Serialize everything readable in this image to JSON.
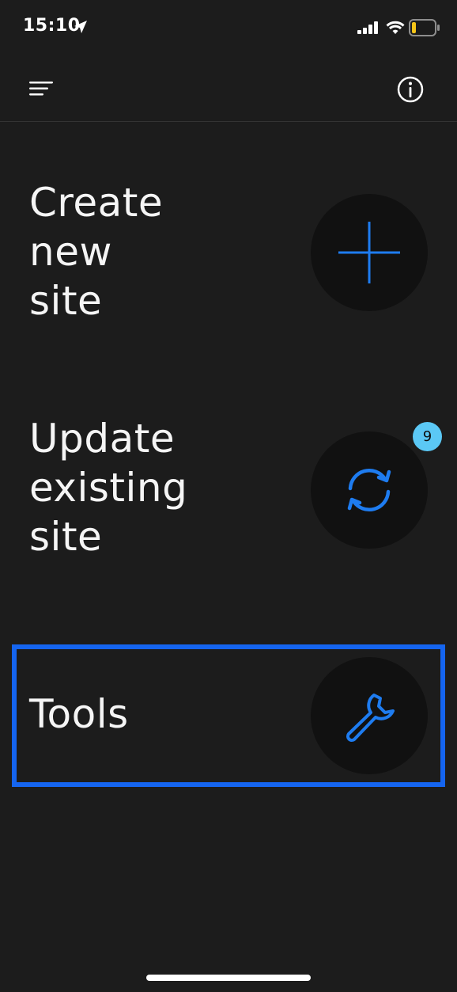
{
  "status_bar": {
    "time": "15:10"
  },
  "actions": {
    "create": {
      "label": "Create\nnew\nsite"
    },
    "update": {
      "label": "Update\nexisting\nsite",
      "badge": "9"
    },
    "tools": {
      "label": "Tools"
    }
  },
  "colors": {
    "background": "#1c1c1c",
    "accent": "#1e7cf0",
    "badge": "#5bc8f5",
    "highlight": "#1565f0"
  },
  "icons": [
    "menu-icon",
    "info-icon",
    "plus-icon",
    "refresh-icon",
    "wrench-icon",
    "location-arrow-icon",
    "signal-icon",
    "wifi-icon",
    "battery-icon"
  ]
}
